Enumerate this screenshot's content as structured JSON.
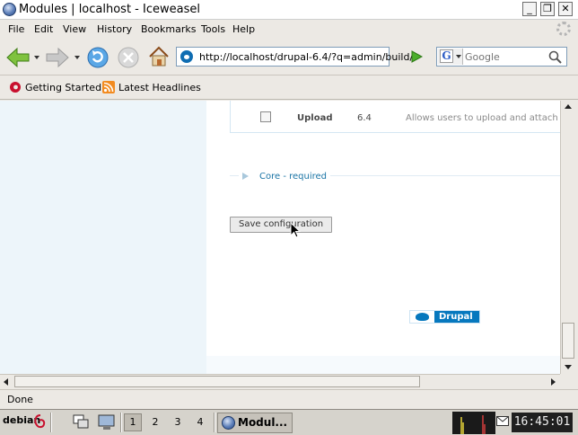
{
  "window": {
    "title": "Modules | localhost - Iceweasel",
    "minimize_label": "_",
    "maximize_label": "❐",
    "close_label": "✕"
  },
  "menu": {
    "items": [
      {
        "label": "File"
      },
      {
        "label": "Edit"
      },
      {
        "label": "View"
      },
      {
        "label": "History"
      },
      {
        "label": "Bookmarks"
      },
      {
        "label": "Tools"
      },
      {
        "label": "Help"
      }
    ]
  },
  "navigation": {
    "url": "http://localhost/drupal-6.4/?q=admin/build/",
    "search_placeholder": "Google",
    "icons": [
      "back-icon",
      "forward-icon",
      "reload-icon",
      "stop-icon",
      "home-icon",
      "go-icon",
      "search-icon"
    ]
  },
  "bookmarks": {
    "items": [
      {
        "label": "Getting Started",
        "icon": "debian-swirl-icon"
      },
      {
        "label": "Latest Headlines",
        "icon": "rss-icon"
      }
    ]
  },
  "page": {
    "module_row": {
      "name": "Upload",
      "version": "6.4",
      "description": "Allows users to upload and attach f"
    },
    "fieldset_legend": "Core - required",
    "save_button": "Save configuration",
    "footer_logo_text": "Drupal"
  },
  "status": {
    "text": "Done"
  },
  "taskbar": {
    "menu_label": "debian",
    "desktops": [
      "1",
      "2",
      "3",
      "4"
    ],
    "active_desktop": "1",
    "task_label": "Modul...",
    "clock": "16:45:01"
  },
  "colors": {
    "link_blue": "#1b75a6",
    "sidebar_bg": "#edf5fa",
    "drupal_blue": "#0678be"
  }
}
